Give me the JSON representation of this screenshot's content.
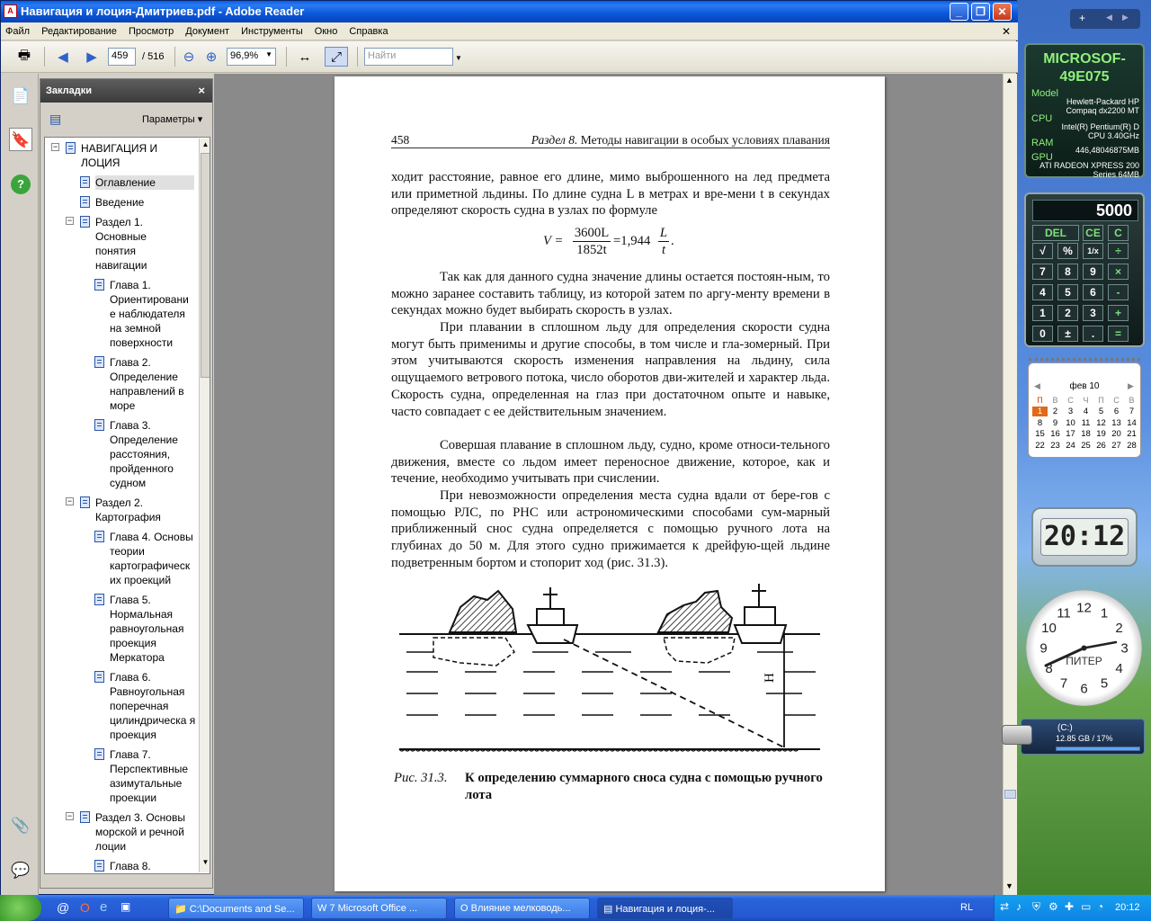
{
  "window": {
    "title": "Навигация и лоция-Дмитриев.pdf - Adobe Reader",
    "controls": {
      "minimize": "_",
      "restore": "❐",
      "close": "✕"
    }
  },
  "menu": [
    "Файл",
    "Редактирование",
    "Просмотр",
    "Документ",
    "Инструменты",
    "Окно",
    "Справка"
  ],
  "toolbar": {
    "current_page": "459",
    "total_pages": "/ 516",
    "zoom": "96,9%",
    "find_placeholder": "Найти"
  },
  "bookmarks": {
    "title": "Закладки",
    "close": "×",
    "options": "Параметры",
    "items": [
      {
        "label": "НАВИГАЦИЯ И ЛОЦИЯ",
        "twisty": "−"
      },
      {
        "label": "Оглавление"
      },
      {
        "label": "Введение"
      },
      {
        "label": "Раздел 1. Основные понятия навигации",
        "twisty": "−"
      },
      {
        "label": "Глава 1. Ориентировани е наблюдателя на земной поверхности"
      },
      {
        "label": "Глава 2. Определение направлений в море"
      },
      {
        "label": "Глава 3. Определение расстояния, пройденного судном"
      },
      {
        "label": "Раздел 2. Картография",
        "twisty": "−"
      },
      {
        "label": "Глава 4. Основы теории картографическ их проекций"
      },
      {
        "label": "Глава 5. Нормальная равноугольная проекция Меркатора"
      },
      {
        "label": "Глава 6. Равноугольная поперечная цилиндрическа я проекция"
      },
      {
        "label": "Глава 7. Перспективные азимутальные проекции"
      },
      {
        "label": "Раздел 3. Основы морской и речной лоции",
        "twisty": "−"
      },
      {
        "label": "Глава 8."
      }
    ]
  },
  "document": {
    "page_number": "458",
    "header_section": "Раздел 8.",
    "header_title": "Методы навигации в особых условиях плавания",
    "para1": "ходит расстояние, равное его длине, мимо выброшенного на лед предмета или приметной льдины. По длине судна L в метрах и вре-мени t в секундах определяют скорость судна в узлах по формуле",
    "formula_lhs": "V =",
    "formula_num": "3600L",
    "formula_den": "1852t",
    "formula_mid": "=1,944",
    "formula_num2": "L",
    "formula_den2": "t",
    "formula_end": ".",
    "para2": "Так как для данного судна значение длины остается постоян-ным, то можно заранее составить таблицу, из которой затем по аргу-менту времени в секундах можно будет выбирать скорость в узлах.",
    "para3": "При плавании в сплошном льду для определения скорости судна могут быть применимы и другие способы, в том числе и гла-зомерный. При этом учитываются скорость изменения направления на льдину, сила ощущаемого ветрового потока, число оборотов дви-жителей и характер льда. Скорость судна, определенная на глаз при достаточном опыте и навыке, часто совпадает с ее действительным значением.",
    "para4": "Совершая плавание в сплошном льду, судно, кроме относи-тельного движения, вместе со льдом имеет переносное движение, которое, как и течение, необходимо учитывать при счислении.",
    "para5": "При невозможности определения места судна вдали от бере-гов с помощью РЛС, по РНС или астрономическими способами сум-марный приближенный снос судна определяется с помощью ручного лота на глубинах до 50 м. Для этого судно прижимается к дрейфую-щей льдине подветренным бортом и стопорит ход (рис. 31.3).",
    "figure_label": "Рис. 31.3.",
    "figure_caption": "К определению суммарного сноса судна с помощью ручного лота",
    "figure_letter": "H"
  },
  "gadgets": {
    "sysinfo": {
      "host": "MICROSOF-49E075",
      "model_label": "Model",
      "model": "Hewlett-Packard HP Compaq dx2200 MT",
      "cpu_label": "CPU",
      "cpu": "Intel(R) Pentium(R) D CPU 3.40GHz",
      "ram_label": "RAM",
      "ram": "446,48046875MB",
      "gpu_label": "GPU",
      "gpu": "ATI RADEON XPRESS 200 Series 64MB"
    },
    "calculator": {
      "display": "5000",
      "keys": [
        "DEL",
        "CE",
        "C",
        "√",
        "%",
        "1/x",
        "÷",
        "7",
        "8",
        "9",
        "×",
        "4",
        "5",
        "6",
        "-",
        "1",
        "2",
        "3",
        "+",
        "0",
        "±",
        ".",
        "="
      ]
    },
    "calendar": {
      "month": "фев 10",
      "weekdays": [
        "П",
        "В",
        "С",
        "Ч",
        "П",
        "С",
        "В"
      ],
      "days": [
        "1",
        "2",
        "3",
        "4",
        "5",
        "6",
        "7",
        "8",
        "9",
        "10",
        "11",
        "12",
        "13",
        "14",
        "15",
        "16",
        "17",
        "18",
        "19",
        "20",
        "21",
        "22",
        "23",
        "24",
        "25",
        "26",
        "27",
        "28"
      ]
    },
    "digital_clock": "20:12",
    "analog_clock": {
      "city": "ПИТЕР",
      "numbers": [
        "12",
        "1",
        "2",
        "3",
        "4",
        "5",
        "6",
        "7",
        "8",
        "9",
        "10",
        "11"
      ]
    },
    "drive": {
      "name": "(C:)",
      "usage": "12.85 GB / 17%"
    }
  },
  "taskbar": {
    "tasks": [
      "C:\\Documents and Se...",
      "7 Microsoft Office ...",
      "Влияние мелководь...",
      "Навигация и лоция-..."
    ],
    "lang": "RL",
    "time": "20:12"
  }
}
